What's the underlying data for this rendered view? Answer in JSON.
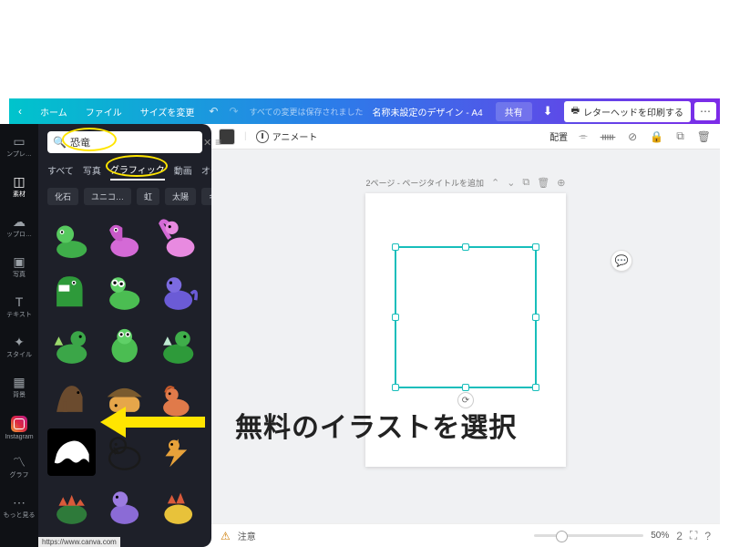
{
  "topbar": {
    "back_label": "ホーム",
    "file_label": "ファイル",
    "resize_label": "サイズを変更",
    "status_text": "すべての変更は保存されました",
    "doc_title": "名称未設定のデザイン - A4",
    "share_label": "共有",
    "print_label": "レターヘッドを印刷する"
  },
  "contextbar": {
    "animate_label": "アニメート",
    "position_label": "配置"
  },
  "rail": {
    "items": [
      {
        "label": "ンプレ…",
        "icon": "▭"
      },
      {
        "label": "素材",
        "icon": "◇"
      },
      {
        "label": "ップロ…",
        "icon": "☁"
      },
      {
        "label": "写真",
        "icon": "▣"
      },
      {
        "label": "テキスト",
        "icon": "T"
      },
      {
        "label": "スタイル",
        "icon": "✦"
      },
      {
        "label": "背景",
        "icon": "▦"
      },
      {
        "label": "Instagram",
        "icon": "insta"
      },
      {
        "label": "グラフ",
        "icon": "〽"
      },
      {
        "label": "もっと見る",
        "icon": "⋯"
      }
    ],
    "active_index": 1
  },
  "panel": {
    "search_value": "恐竜",
    "tabs": [
      "すべて",
      "写真",
      "グラフィック",
      "動画",
      "オー…"
    ],
    "active_tab_index": 2,
    "chips": [
      "化石",
      "ユニコ…",
      "虹",
      "太陽",
      "キリン"
    ]
  },
  "canvas": {
    "page_title_placeholder": "2ページ - ページタイトルを追加"
  },
  "bottombar": {
    "notes_label": "注意",
    "zoom_label": "50%",
    "page_indicator": "2"
  },
  "annotation": {
    "text": "無料のイラストを選択"
  },
  "url_hint": "https://www.canva.com"
}
